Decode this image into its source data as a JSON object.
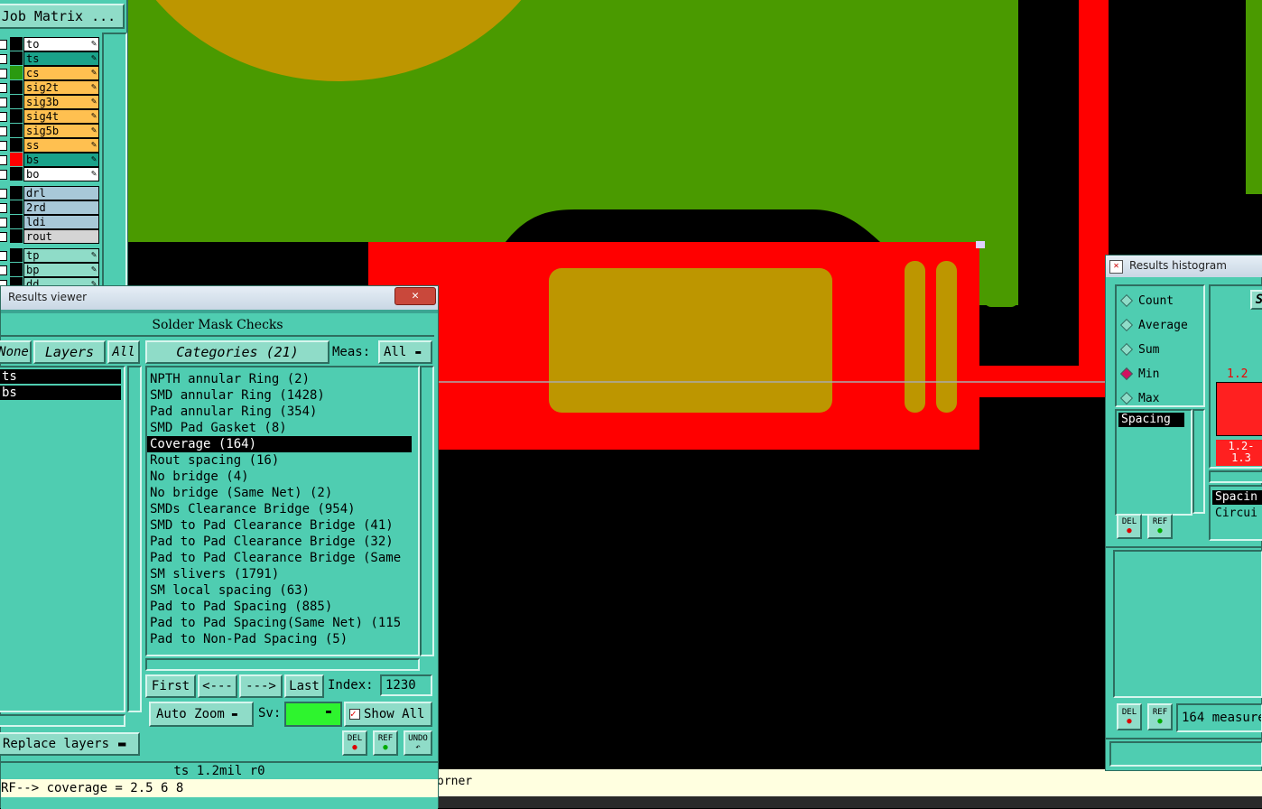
{
  "job_matrix": {
    "button_label": "Job Matrix ...",
    "layers": [
      {
        "name": "to",
        "color": "#ffffff",
        "swatch": "#000000"
      },
      {
        "name": "ts",
        "color": "#1aa28a",
        "swatch": "#000000"
      },
      {
        "name": "cs",
        "color": "#ffc050",
        "swatch": "#2a9a10"
      },
      {
        "name": "sig2t",
        "color": "#ffc050",
        "swatch": "#000000"
      },
      {
        "name": "sig3b",
        "color": "#ffc050",
        "swatch": "#000000"
      },
      {
        "name": "sig4t",
        "color": "#ffc050",
        "swatch": "#000000"
      },
      {
        "name": "sig5b",
        "color": "#ffc050",
        "swatch": "#000000"
      },
      {
        "name": "ss",
        "color": "#ffc050",
        "swatch": "#000000"
      },
      {
        "name": "bs",
        "color": "#1aa28a",
        "swatch": "#ff0000"
      },
      {
        "name": "bo",
        "color": "#ffffff",
        "swatch": "#000000"
      }
    ],
    "drill_layers": [
      "drl",
      "2rd",
      "ldi",
      "rout"
    ],
    "bottom_layers": [
      "tp",
      "bp",
      "dd"
    ]
  },
  "results_viewer": {
    "title": "Results viewer",
    "close_label": "✕",
    "header": "Solder Mask Checks",
    "none_label": "None",
    "layers_label": "Layers",
    "all_label": "All",
    "categories_label": "Categories (21)",
    "meas_label": "Meas:",
    "meas_value": "All",
    "left_list": [
      "ts",
      "bs"
    ],
    "categories": [
      "NPTH annular Ring (2)",
      "SMD annular Ring (1428)",
      "Pad annular Ring (354)",
      "SMD Pad Gasket (8)",
      "Coverage (164)",
      "Rout spacing (16)",
      "No bridge (4)",
      "No bridge (Same Net) (2)",
      "SMDs Clearance Bridge (954)",
      "SMD to Pad Clearance Bridge (41)",
      "Pad to Pad Clearance Bridge (32)",
      "Pad to Pad Clearance Bridge (Same",
      "SM slivers (1791)",
      "SM local spacing (63)",
      "Pad to Pad Spacing (885)",
      "Pad to Pad Spacing(Same Net) (115",
      "Pad to Non-Pad Spacing (5)"
    ],
    "selected_category": 4,
    "nav": {
      "first": "First",
      "prev": "<---",
      "next": "--->",
      "last": "Last",
      "index_label": "Index:",
      "index_value": "1230"
    },
    "auto_zoom_label": "Auto Zoom",
    "sv_label": "Sv:",
    "show_all_label": "Show All",
    "replace_layers_label": "Replace layers",
    "del_label": "DEL",
    "ref_label": "REF",
    "undo_label": "UNDO",
    "status_line": "ts 1.2mil  r0",
    "message_line": "RF--> coverage = 2.5 6 8"
  },
  "bottom_bar_text": "orner",
  "histogram": {
    "title": "Results histogram",
    "modes": [
      "Count",
      "Average",
      "Sum",
      "Min",
      "Max"
    ],
    "selected_mode": "Min",
    "measure_list": [
      "Spacing"
    ],
    "bar_top_label": "1.2",
    "bin_label_1": "1.2-",
    "bin_label_2": "1.3",
    "right_list": [
      "Spacin",
      "Circui"
    ],
    "s_label": "S",
    "del_label": "DEL",
    "ref_label": "REF",
    "measure_count_text": "164 measure"
  }
}
